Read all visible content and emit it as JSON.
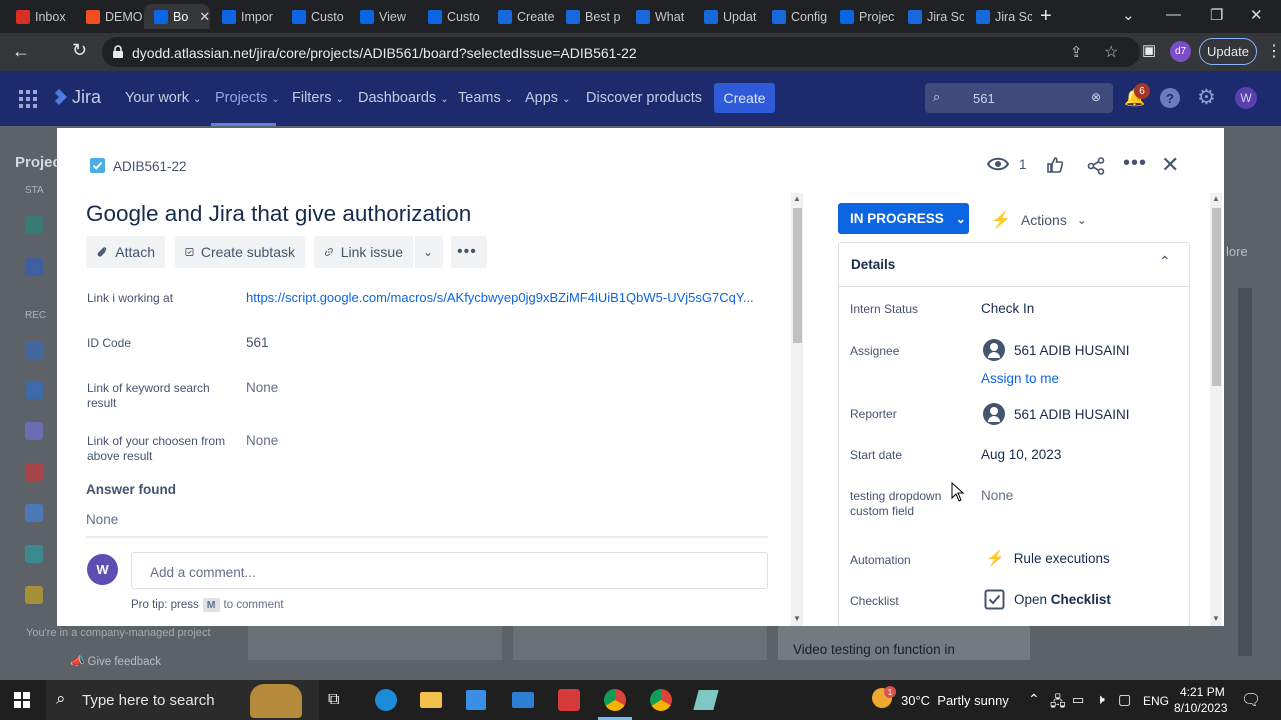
{
  "browser": {
    "tabs": [
      {
        "label": "Inbox",
        "color": "#d93025"
      },
      {
        "label": "DEMO",
        "color": "#f24e1e"
      },
      {
        "label": "Bo",
        "color": "#0c66e4",
        "active": true
      },
      {
        "label": "Impor",
        "color": "#0c66e4"
      },
      {
        "label": "Custo",
        "color": "#0c66e4"
      },
      {
        "label": "View",
        "color": "#0c66e4"
      },
      {
        "label": "Custo",
        "color": "#0c66e4"
      },
      {
        "label": "Create",
        "color": "#1868db"
      },
      {
        "label": "Best p",
        "color": "#1868db"
      },
      {
        "label": "What",
        "color": "#1868db"
      },
      {
        "label": "Updat",
        "color": "#1868db"
      },
      {
        "label": "Config",
        "color": "#1868db"
      },
      {
        "label": "Projec",
        "color": "#0c66e4"
      },
      {
        "label": "Jira Sc",
        "color": "#1868db"
      },
      {
        "label": "Jira Sc",
        "color": "#1868db"
      }
    ],
    "url": "dyodd.atlassian.net/jira/core/projects/ADIB561/board?selectedIssue=ADIB561-22",
    "update_label": "Update",
    "profile_badge": "d7"
  },
  "jira_nav": {
    "logo": "Jira",
    "items": [
      "Your work",
      "Projects",
      "Filters",
      "Dashboards",
      "Teams",
      "Apps"
    ],
    "discover": "Discover products",
    "create": "Create",
    "search_value": "561",
    "notification_count": "6",
    "user_initial": "W"
  },
  "background_page": {
    "projects_fragment": "Projec",
    "starred_fragment": "STA",
    "recent_fragment": "REC",
    "more_fragment": "lore",
    "company_note": "You're in a company-managed project",
    "feedback": "Give feedback",
    "card_text": "Video testing on function in"
  },
  "issue": {
    "key": "ADIB561-22",
    "title": "Google and Jira that give authorization",
    "watchers": "1",
    "toolbar": {
      "attach": "Attach",
      "create_subtask": "Create subtask",
      "link_issue": "Link issue"
    },
    "fields": [
      {
        "label": "Link i working at",
        "value": "https://script.google.com/macros/s/AKfycbwyep0jg9xBZiMF4iUiB1QbW5-UVj5sG7CqY..."
      },
      {
        "label": "ID Code",
        "value": "561"
      },
      {
        "label": "Link of keyword search result",
        "value": "None"
      },
      {
        "label": "Link of your choosen from above result",
        "value": "None"
      }
    ],
    "answer_heading": "Answer found",
    "answer_value": "None",
    "comment": {
      "avatar": "W",
      "placeholder": "Add a comment...",
      "tip_prefix": "Pro tip: press",
      "tip_key": "M",
      "tip_suffix": "to comment"
    },
    "status": "IN PROGRESS",
    "actions": "Actions",
    "details_heading": "Details",
    "details": {
      "intern_status_label": "Intern Status",
      "intern_status_value": "Check In",
      "assignee_label": "Assignee",
      "assignee_value": "561 ADIB HUSAINI",
      "assign_to_me": "Assign to me",
      "reporter_label": "Reporter",
      "reporter_value": "561 ADIB HUSAINI",
      "start_date_label": "Start date",
      "start_date_value": "Aug 10, 2023",
      "dropdown_label": "testing dropdown custom field",
      "dropdown_value": "None",
      "automation_label": "Automation",
      "automation_value": "Rule executions",
      "checklist_label": "Checklist",
      "checklist_value_prefix": "Open",
      "checklist_value_bold": "Checklist"
    }
  },
  "taskbar": {
    "search_placeholder": "Type here to search",
    "weather": "30°C  Partly sunny",
    "language": "ENG",
    "time": "4:21 PM",
    "date": "8/10/2023",
    "notification_badge": "1"
  }
}
